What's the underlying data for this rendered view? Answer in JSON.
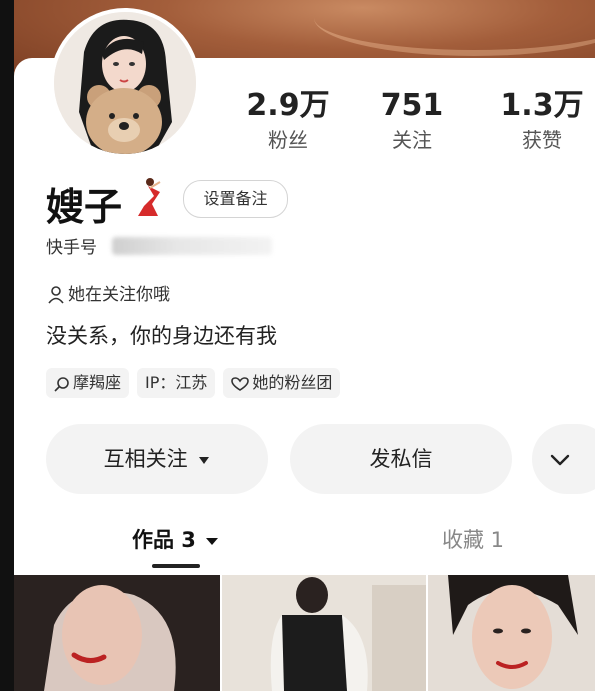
{
  "profile": {
    "name": "嫂子",
    "kuaishou_label": "快手号",
    "follow_note": "她在关注你哦",
    "bio": "没关系，你的身边还有我",
    "remark_button": "设置备注"
  },
  "stats": [
    {
      "value": "2.9万",
      "label": "粉丝"
    },
    {
      "value": "751",
      "label": "关注"
    },
    {
      "value": "1.3万",
      "label": "获赞"
    }
  ],
  "tags": [
    {
      "icon": "search-icon",
      "label": "摩羯座"
    },
    {
      "icon": "",
      "label": "IP：江苏"
    },
    {
      "icon": "heart-outline-icon",
      "label": "她的粉丝团"
    }
  ],
  "actions": {
    "follow_label": "互相关注",
    "message_label": "发私信"
  },
  "tabs": {
    "works_label": "作品 3",
    "favorites_label": "收藏 1"
  },
  "colors": {
    "banner": "#a35e3b",
    "button_bg": "#f3f3f3",
    "text_primary": "#222222"
  }
}
